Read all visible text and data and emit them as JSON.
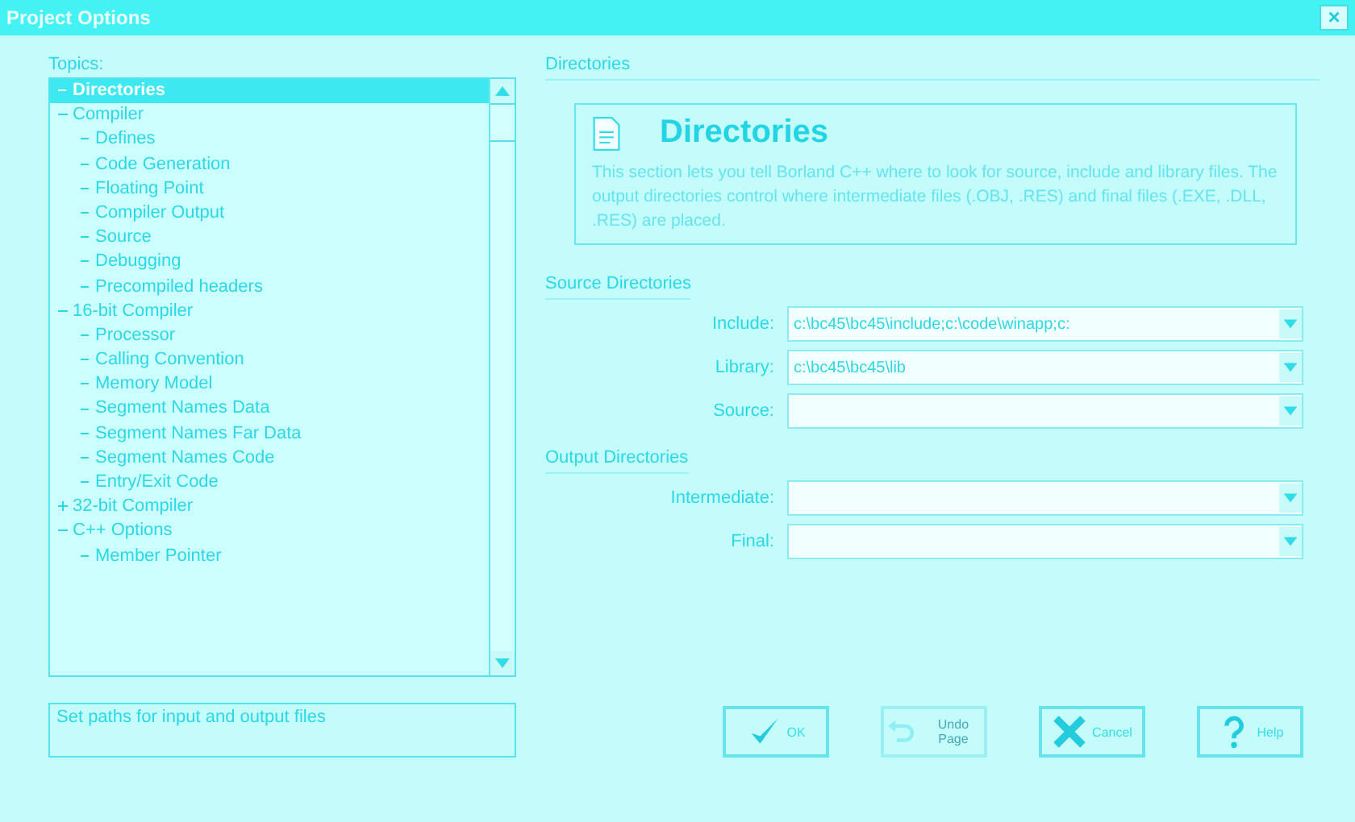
{
  "window": {
    "title": "Project Options",
    "close": "×"
  },
  "topics": {
    "label": "Topics:",
    "items": [
      {
        "label": "Directories",
        "selected": true
      },
      {
        "label": "Compiler",
        "selected": false,
        "expanded": true,
        "children": [
          {
            "label": "Defines",
            "selected": false
          },
          {
            "label": "Code Generation",
            "selected": false
          },
          {
            "label": "Floating Point",
            "selected": false
          },
          {
            "label": "Compiler Output",
            "selected": false
          },
          {
            "label": "Source",
            "selected": false
          },
          {
            "label": "Debugging",
            "selected": false
          },
          {
            "label": "Precompiled headers",
            "selected": false
          }
        ]
      },
      {
        "label": "16-bit Compiler",
        "selected": false,
        "expanded": true,
        "children": [
          {
            "label": "Processor",
            "selected": false
          },
          {
            "label": "Calling Convention",
            "selected": false
          },
          {
            "label": "Memory Model",
            "selected": false
          },
          {
            "label": "Segment Names Data",
            "selected": false
          },
          {
            "label": "Segment Names Far Data",
            "selected": false
          },
          {
            "label": "Segment Names Code",
            "selected": false
          },
          {
            "label": "Entry/Exit Code",
            "selected": false
          }
        ]
      },
      {
        "label": "32-bit Compiler",
        "selected": false,
        "expanded": false
      },
      {
        "label": "C++ Options",
        "selected": false,
        "expanded": true,
        "children": [
          {
            "label": "Member Pointer",
            "selected": false
          }
        ]
      }
    ]
  },
  "status": "Set paths for input and output files",
  "section": {
    "title": "Directories",
    "heading": "Directories",
    "description": "This section lets you tell Borland C++ where to look for source, include and library files. The output directories control where intermediate files (.OBJ, .RES) and final files (.EXE, .DLL, .RES) are placed."
  },
  "groups": [
    {
      "title": "Source Directories",
      "fields": [
        {
          "label": "Include:",
          "value": "c:\\bc45\\bc45\\include;c:\\code\\winapp;c:"
        },
        {
          "label": "Library:",
          "value": "c:\\bc45\\bc45\\lib"
        },
        {
          "label": "Source:"
        }
      ]
    },
    {
      "title": "Output Directories",
      "fields": [
        {
          "label": "Intermediate:"
        },
        {
          "label": "Final:"
        }
      ]
    }
  ],
  "buttons": [
    {
      "kind": "ok",
      "label": "OK",
      "disabled": false
    },
    {
      "kind": "undo",
      "label": "Undo Page",
      "disabled": true
    },
    {
      "kind": "cancel",
      "label": "Cancel",
      "disabled": false
    },
    {
      "kind": "help",
      "label": "Help",
      "disabled": false
    }
  ]
}
